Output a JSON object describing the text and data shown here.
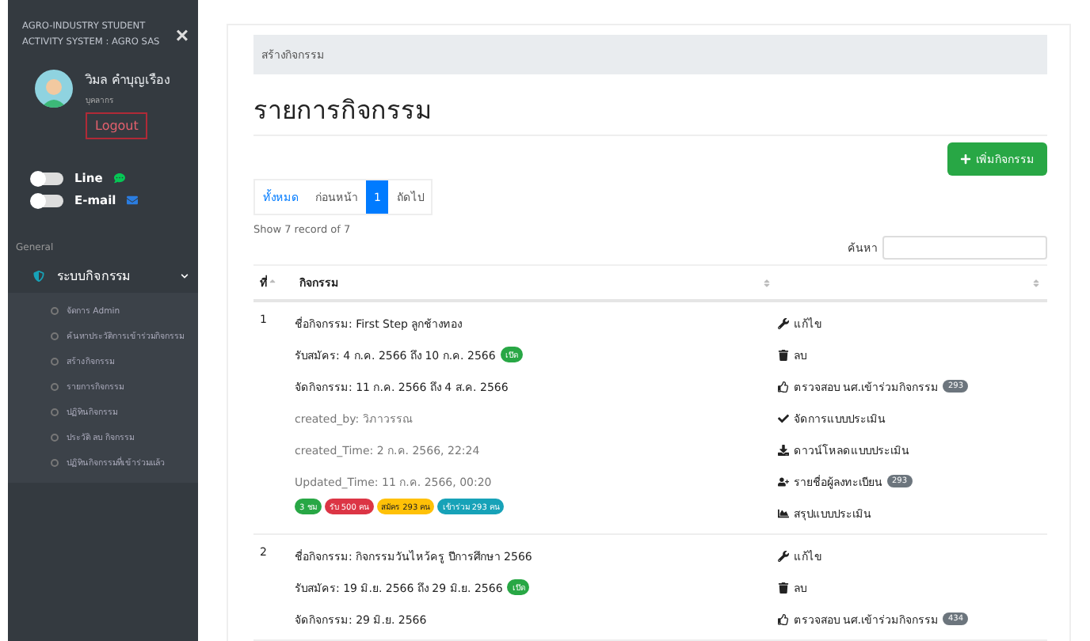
{
  "sidebar": {
    "brand": "AGRO-INDUSTRY STUDENT ACTIVITY SYSTEM : AGRO SAS",
    "close": "×",
    "user": {
      "name": "วิมล คำบุญเรือง",
      "role": "บุคลากร",
      "logout": "Logout"
    },
    "notifications": [
      {
        "kind": "line",
        "label": "Line",
        "on": false
      },
      {
        "kind": "email",
        "label": "E-mail",
        "on": false
      }
    ],
    "section": "General",
    "menu": {
      "label": "ระบบกิจกรรม",
      "expanded": true,
      "items": [
        {
          "label": "จัดการ Admin"
        },
        {
          "label": "ค้นหาประวัติการเข้าร่วมกิจกรรม"
        },
        {
          "label": "สร้างกิจกรรม"
        },
        {
          "label": "รายการกิจกรรม"
        },
        {
          "label": "ปฏิทินกิจกรรม"
        },
        {
          "label": "ประวัติ ลบ กิจกรรม"
        },
        {
          "label": "ปฏิทินกิจกรรมที่เข้าร่วมแล้ว"
        }
      ]
    }
  },
  "breadcrumb": "สร้างกิจกรรม",
  "title": "รายการกิจกรรม",
  "add_button": "เพิ่มกิจกรรม",
  "pagination": [
    {
      "label": "ทั้งหมด",
      "kind": "link",
      "selected": false
    },
    {
      "label": "ก่อนหน้า",
      "kind": "text",
      "selected": false
    },
    {
      "label": "1",
      "kind": "text",
      "selected": true
    },
    {
      "label": "ถัดไป",
      "kind": "text",
      "selected": false
    }
  ],
  "record_info": "Show 7 record of 7",
  "search": {
    "label": "ค้นหา"
  },
  "table": {
    "columns": [
      "ที่",
      "กิจกรรม"
    ],
    "rows": [
      {
        "number": "1",
        "lines": [
          {
            "kind": "main",
            "text": "ชื่อกิจกรรม: First Step ลูกช้างทอง"
          },
          {
            "kind": "main",
            "text": "รับสมัคร: 4 ก.ค. 2566 ถึง 10 ก.ค. 2566",
            "badge": "เปิด"
          },
          {
            "kind": "main",
            "text": "จัดกิจกรรม: 11 ก.ค. 2566 ถึง 4 ส.ค. 2566"
          },
          {
            "kind": "meta",
            "text": "created_by: วิภาวรรณ"
          },
          {
            "kind": "meta",
            "text": "created_Time: 2 ก.ค. 2566, 22:24"
          },
          {
            "kind": "meta",
            "text": "Updated_Time: 11 ก.ค. 2566, 00:20"
          }
        ],
        "tags": [
          {
            "text": "3 ชม",
            "color": "#28a745"
          },
          {
            "text": "รับ 500 คน",
            "color": "#dc3545"
          },
          {
            "text": "สมัคร 293 คน",
            "color": "#ffc107"
          },
          {
            "text": "เข้าร่วม 293 คน",
            "color": "#17a2b8"
          }
        ],
        "actions": [
          {
            "kind": "edit",
            "label": "แก้ไข"
          },
          {
            "kind": "delete",
            "label": "ลบ"
          },
          {
            "kind": "check",
            "label": "ตรวจสอบ นศ.เข้าร่วมกิจกรรม",
            "count": "293"
          },
          {
            "kind": "manage",
            "label": "จัดการแบบประเมิน"
          },
          {
            "kind": "download",
            "label": "ดาวน์โหลดแบบประเมิน"
          },
          {
            "kind": "register",
            "label": "รายชื่อผู้ลงทะเบียน",
            "count": "293"
          },
          {
            "kind": "summary",
            "label": "สรุปแบบประเมิน"
          }
        ]
      },
      {
        "number": "2",
        "lines": [
          {
            "kind": "main",
            "text": "ชื่อกิจกรรม: กิจกรรมวันไหว้ครู ปีการศึกษา 2566"
          },
          {
            "kind": "main",
            "text": "รับสมัคร: 19 มิ.ย. 2566 ถึง 29 มิ.ย. 2566",
            "badge": "เปิด"
          },
          {
            "kind": "main",
            "text": "จัดกิจกรรม: 29 มิ.ย. 2566"
          }
        ],
        "tags": [],
        "actions": [
          {
            "kind": "edit",
            "label": "แก้ไข"
          },
          {
            "kind": "delete",
            "label": "ลบ"
          },
          {
            "kind": "check",
            "label": "ตรวจสอบ นศ.เข้าร่วมกิจกรรม",
            "count": "434"
          }
        ]
      }
    ]
  }
}
